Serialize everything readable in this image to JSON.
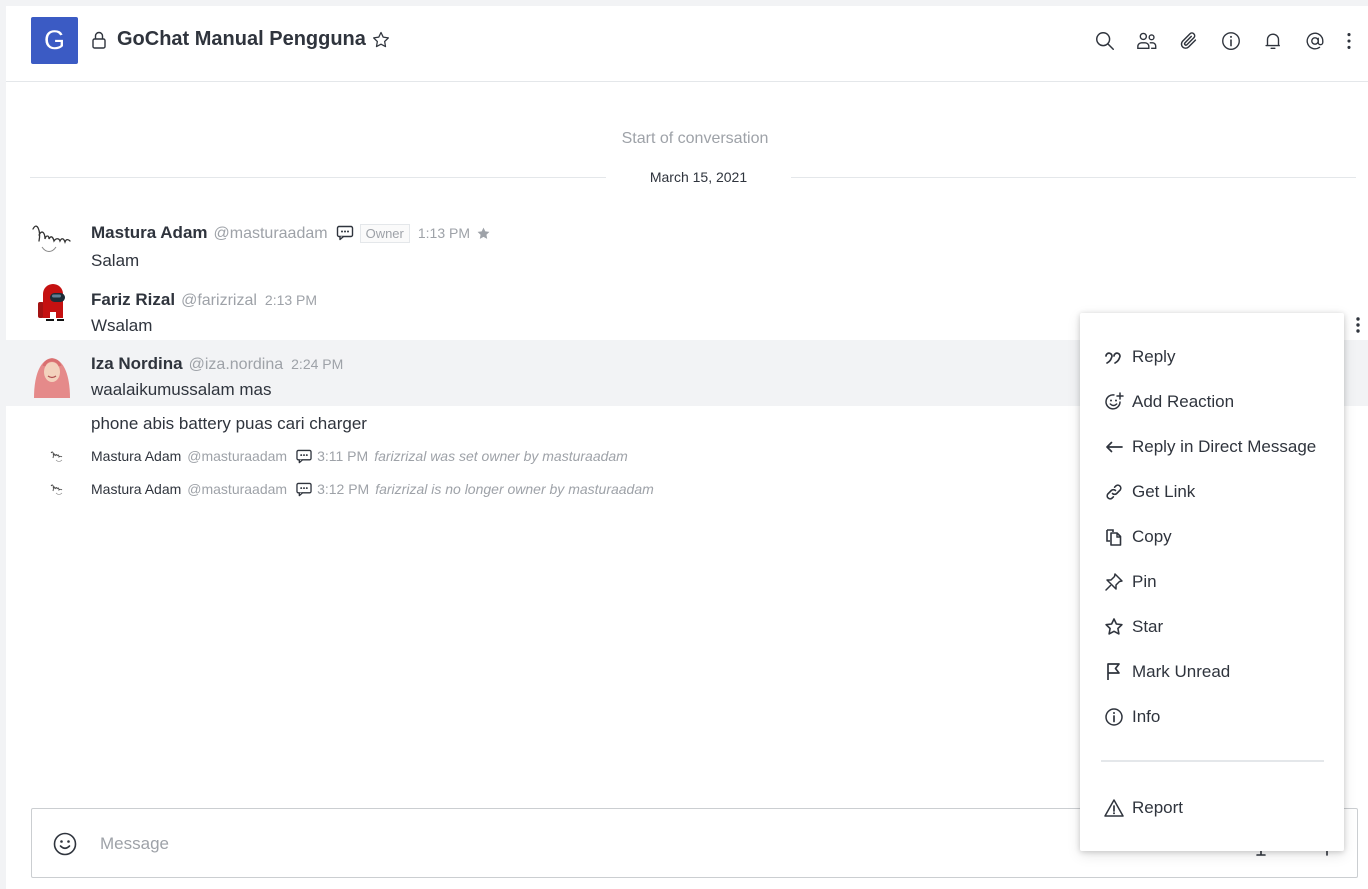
{
  "room": {
    "avatar_letter": "G",
    "title": "GoChat Manual Pengguna",
    "accent_color": "#3b5bc4"
  },
  "header_icons": [
    "search-icon",
    "members-icon",
    "attachment-icon",
    "info-icon",
    "bell-icon",
    "mention-icon",
    "kebab-icon"
  ],
  "conversation": {
    "start_text": "Start of conversation",
    "date": "March 15, 2021"
  },
  "messages": [
    {
      "author": "Mastura Adam",
      "username": "@masturaadam",
      "role": "Owner",
      "time": "1:13 PM",
      "text": "Salam",
      "starred": true
    },
    {
      "author": "Fariz Rizal",
      "username": "@farizrizal",
      "time": "2:13 PM",
      "text": "Wsalam"
    },
    {
      "author": "Iza Nordina",
      "username": "@iza.nordina",
      "time": "2:24 PM",
      "text": "waalaikumussalam mas",
      "followup": "phone abis battery puas cari charger"
    }
  ],
  "system_messages": [
    {
      "author": "Mastura Adam",
      "username": "@masturaadam",
      "time": "3:11 PM",
      "text": "farizrizal was set owner by masturaadam"
    },
    {
      "author": "Mastura Adam",
      "username": "@masturaadam",
      "time": "3:12 PM",
      "text": "farizrizal is no longer owner by masturaadam"
    }
  ],
  "composer": {
    "placeholder": "Message"
  },
  "context_menu": {
    "items": [
      {
        "label": "Reply",
        "icon": "quote-icon"
      },
      {
        "label": "Add Reaction",
        "icon": "add-reaction-icon"
      },
      {
        "label": "Reply in Direct Message",
        "icon": "reply-arrow-icon"
      },
      {
        "label": "Get Link",
        "icon": "link-icon"
      },
      {
        "label": "Copy",
        "icon": "copy-icon"
      },
      {
        "label": "Pin",
        "icon": "pin-icon"
      },
      {
        "label": "Star",
        "icon": "star-icon"
      },
      {
        "label": "Mark Unread",
        "icon": "flag-icon"
      },
      {
        "label": "Info",
        "icon": "info-icon"
      }
    ],
    "report": {
      "label": "Report",
      "icon": "warning-icon"
    }
  }
}
